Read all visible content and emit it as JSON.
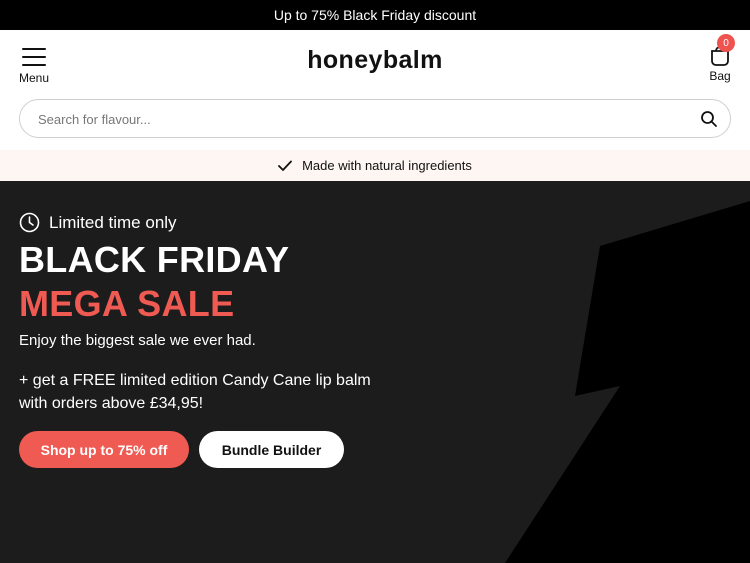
{
  "promo_bar": {
    "text": "Up to 75% Black Friday discount"
  },
  "header": {
    "menu_label": "Menu",
    "logo": "honeybalm",
    "bag_label": "Bag",
    "bag_count": "0"
  },
  "search": {
    "placeholder": "Search for flavour..."
  },
  "usp": {
    "text": "Made with natural ingredients"
  },
  "hero": {
    "eyebrow": "Limited time only",
    "title_line1": "BLACK FRIDAY",
    "title_line2": "MEGA SALE",
    "subtitle": "Enjoy the biggest sale we ever had.",
    "offer_line1": "+ get a FREE limited edition Candy Cane lip balm",
    "offer_line2": "with orders above £34,95!",
    "primary_cta": "Shop up to 75% off",
    "secondary_cta": "Bundle Builder"
  },
  "colors": {
    "accent": "#ef5a52",
    "hero_bg": "#1c1c1c",
    "usp_bg": "#fdf6f2"
  },
  "icons": [
    "menu-icon",
    "bag-icon",
    "search-icon",
    "checkmark-icon",
    "clock-icon"
  ]
}
